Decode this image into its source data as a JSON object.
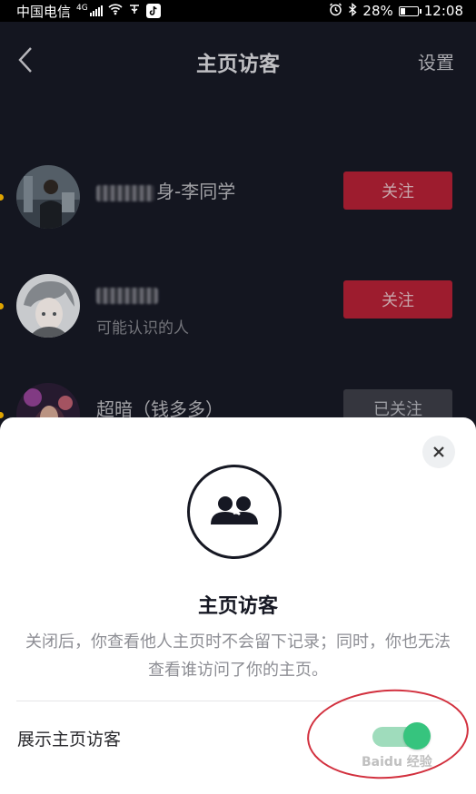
{
  "status_bar": {
    "carrier": "中国电信",
    "network": "4G",
    "battery": "28%",
    "battery_level": 0.28,
    "time": "12:08"
  },
  "header": {
    "title": "主页访客",
    "settings_label": "设置"
  },
  "visitors": [
    {
      "name_visible": "身-李同学",
      "follow_label": "关注",
      "followed": false
    },
    {
      "name_visible": "",
      "subtitle": "可能认识的人",
      "follow_label": "关注",
      "followed": false
    },
    {
      "name_visible": "超暗（钱多多）",
      "follow_label": "已关注",
      "followed": true
    }
  ],
  "sheet": {
    "title": "主页访客",
    "description": "关闭后，你查看他人主页时不会留下记录；同时，你也无法查看谁访问了你的主页。",
    "toggle_label": "展示主页访客",
    "toggle_on": true
  },
  "colors": {
    "background": "#161823",
    "follow_button": "#ab1f32",
    "toggle_on": "#36c47e"
  },
  "watermark": "Baidu 经验"
}
